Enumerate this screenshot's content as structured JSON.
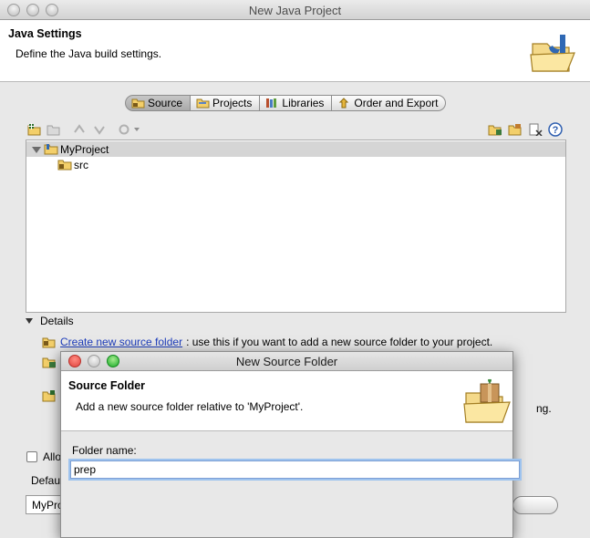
{
  "window": {
    "title": "New Java Project"
  },
  "header": {
    "title": "Java Settings",
    "description": "Define the Java build settings."
  },
  "tabs": [
    {
      "label": "Source",
      "icon": "source-folder-icon",
      "active": true
    },
    {
      "label": "Projects",
      "icon": "projects-icon",
      "active": false
    },
    {
      "label": "Libraries",
      "icon": "libraries-icon",
      "active": false
    },
    {
      "label": "Order and Export",
      "icon": "order-export-icon",
      "active": false
    }
  ],
  "tree": {
    "project": "MyProject",
    "children": [
      "src"
    ]
  },
  "details": {
    "heading": "Details",
    "link_text": "Create new source folder",
    "link_suffix": ": use this if you want to add a new source folder to your project.",
    "partial_right": "ng.",
    "checkbox_partial": "Allo",
    "default_partial": "Defau",
    "output_partial": "MyProj"
  },
  "dialog": {
    "title": "New Source Folder",
    "header_title": "Source Folder",
    "header_description": "Add a new source folder relative to 'MyProject'.",
    "field_label": "Folder name:",
    "field_value": "prep"
  },
  "colors": {
    "link": "#1d3dbd",
    "focus": "#9ec3ee",
    "close": "#e0443e",
    "minimize": "#dea123",
    "zoom": "#1aab29"
  }
}
